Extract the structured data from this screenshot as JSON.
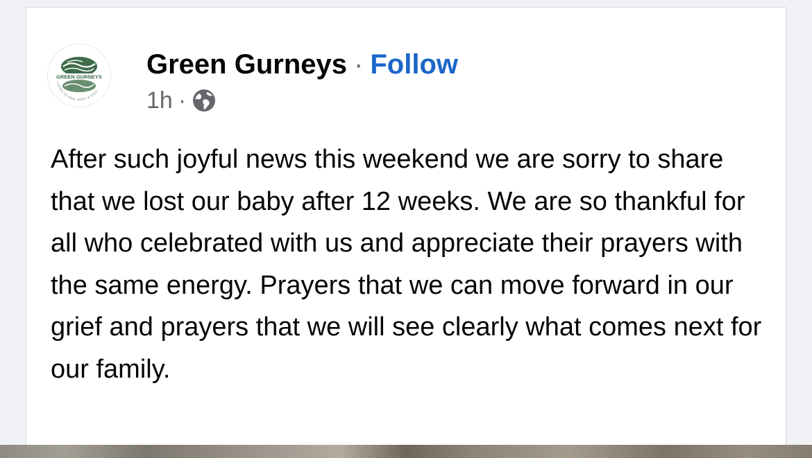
{
  "post": {
    "author": "Green Gurneys",
    "separator": "·",
    "follow_label": "Follow",
    "time": "1h",
    "time_separator": "·",
    "audience_icon": "globe-icon",
    "avatar_text_top": "GREEN GURNEYS",
    "avatar_text_bottom": "LISTEN TO HEAL BODY & SOUL",
    "body": "After such joyful news this weekend we are sorry to share that we lost our baby after 12 weeks. We are so thankful for all who celebrated with us and appreciate their prayers with the same energy. Prayers that we can move forward in our grief and prayers that we will see clearly what comes next for our family."
  },
  "colors": {
    "follow": "#1b66c9",
    "text": "#050505",
    "secondary": "#65676b",
    "logo_green": "#3f6b4a"
  }
}
